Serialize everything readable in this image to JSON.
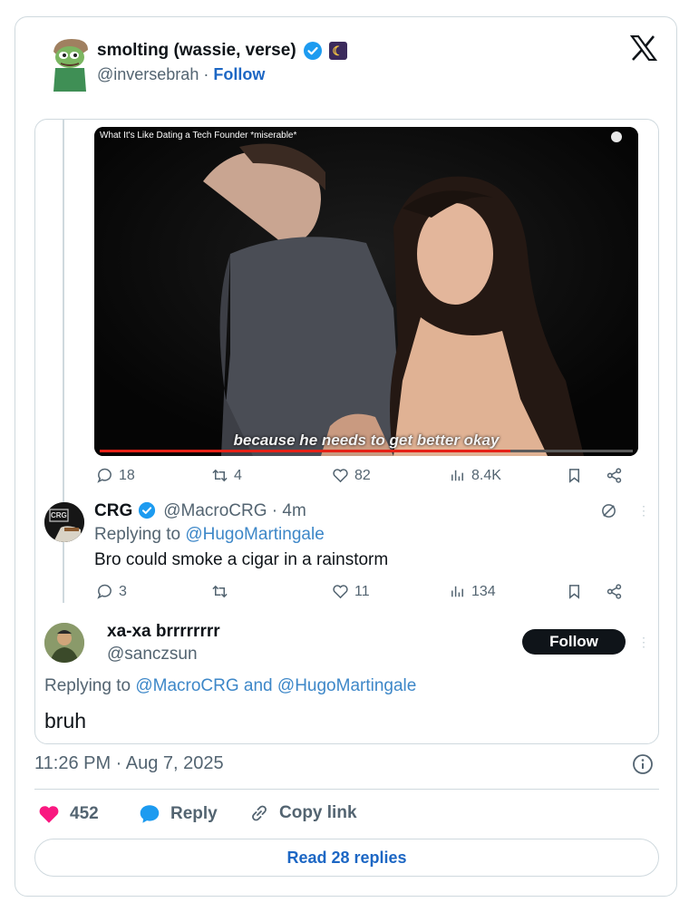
{
  "author": {
    "name": "smolting (wassie, verse)",
    "handle": "@inversebrah",
    "separator": "·",
    "follow_label": "Follow"
  },
  "video": {
    "title": "What It's Like Dating a Tech Founder *miserable*",
    "caption": "because he needs to get better okay",
    "progress": 0.77
  },
  "embedded_metrics": {
    "replies": "18",
    "reposts": "4",
    "likes": "82",
    "views": "8.4K"
  },
  "reply": {
    "avatar_text": "CRG",
    "name": "CRG",
    "handle": "@MacroCRG · 4m",
    "replying_prefix": "Replying to",
    "replying_to": "@HugoMartingale",
    "text": "Bro could smoke a cigar in a rainstorm",
    "metrics": {
      "replies": "3",
      "reposts": "",
      "likes": "11",
      "views": "134"
    }
  },
  "quote": {
    "name": "xa-xa brrrrrrrr",
    "handle": "@sanczsun",
    "follow_label": "Follow",
    "replying_prefix": "Replying to",
    "replying_to_1": "@MacroCRG",
    "and": "and",
    "replying_to_2": "@HugoMartingale",
    "text": "bruh"
  },
  "timestamp": "11:26 PM · Aug 7, 2025",
  "footer": {
    "likes": "452",
    "reply_label": "Reply",
    "copy_label": "Copy link",
    "read_replies": "Read 28 replies"
  },
  "colors": {
    "accent": "#1d9bf0",
    "link": "#1d67c4",
    "heart": "#f91880",
    "muted": "#536471"
  }
}
